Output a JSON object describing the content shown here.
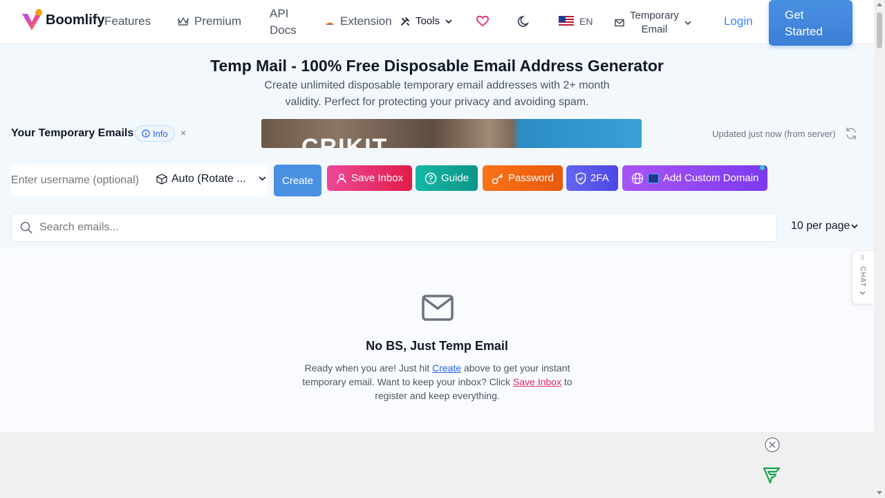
{
  "header": {
    "logo_text": "Boomlify",
    "nav": {
      "features": "Features",
      "premium": "Premium",
      "api_line1": "API",
      "api_line2": "Docs",
      "extension": "Extension",
      "tools": "Tools",
      "lang": "EN",
      "temp_line1": "Temporary",
      "temp_line2": "Email",
      "login": "Login"
    },
    "cta_line1": "Get",
    "cta_line2": "Started"
  },
  "hero": {
    "title": "Temp Mail - 100% Free Disposable Email Address Generator",
    "subtitle": "Create unlimited disposable temporary email addresses with 2+ month validity. Perfect for protecting your privacy and avoiding spam."
  },
  "emails_section": {
    "label": "Your Temporary Emails",
    "info_badge": "Info",
    "close_glyph": "×",
    "banner_text": "CRIKIT",
    "updated_text": "Updated just now (from server)"
  },
  "controls": {
    "username_placeholder": "Enter username (optional)",
    "domain_selected": "Auto (Rotate ...",
    "create": "Create",
    "save_inbox": "Save Inbox",
    "guide": "Guide",
    "password": "Password",
    "twofa": "2FA",
    "add_domain": "Add Custom Domain"
  },
  "search": {
    "placeholder": "Search emails...",
    "per_page": "10 per page"
  },
  "chat": {
    "label": "CHAT"
  },
  "empty_state": {
    "title": "No BS, Just Temp Email",
    "text_1": "Ready when you are! Just hit ",
    "link_create": "Create",
    "text_2": " above to get your instant temporary email. Want to keep your inbox? Click ",
    "link_save": "Save Inbox",
    "text_3": " to register and keep everything."
  },
  "colors": {
    "accent": "#4a90e2",
    "save_inbox": "#e11d48",
    "guide": "#0d9488",
    "password": "#ea580c",
    "twofa": "#4f46e5",
    "custom_domain": "#7c3aed"
  },
  "icons": [
    "logo-icon",
    "crown-icon",
    "puzzle-icon",
    "tools-icon",
    "heart-icon",
    "moon-icon",
    "us-flag-icon",
    "mail-icon",
    "refresh-icon",
    "cube-icon",
    "user-icon",
    "help-icon",
    "key-icon",
    "shield-icon",
    "globe-icon",
    "search-icon",
    "envelope-icon",
    "close-circle-icon",
    "ad-logo-icon"
  ]
}
